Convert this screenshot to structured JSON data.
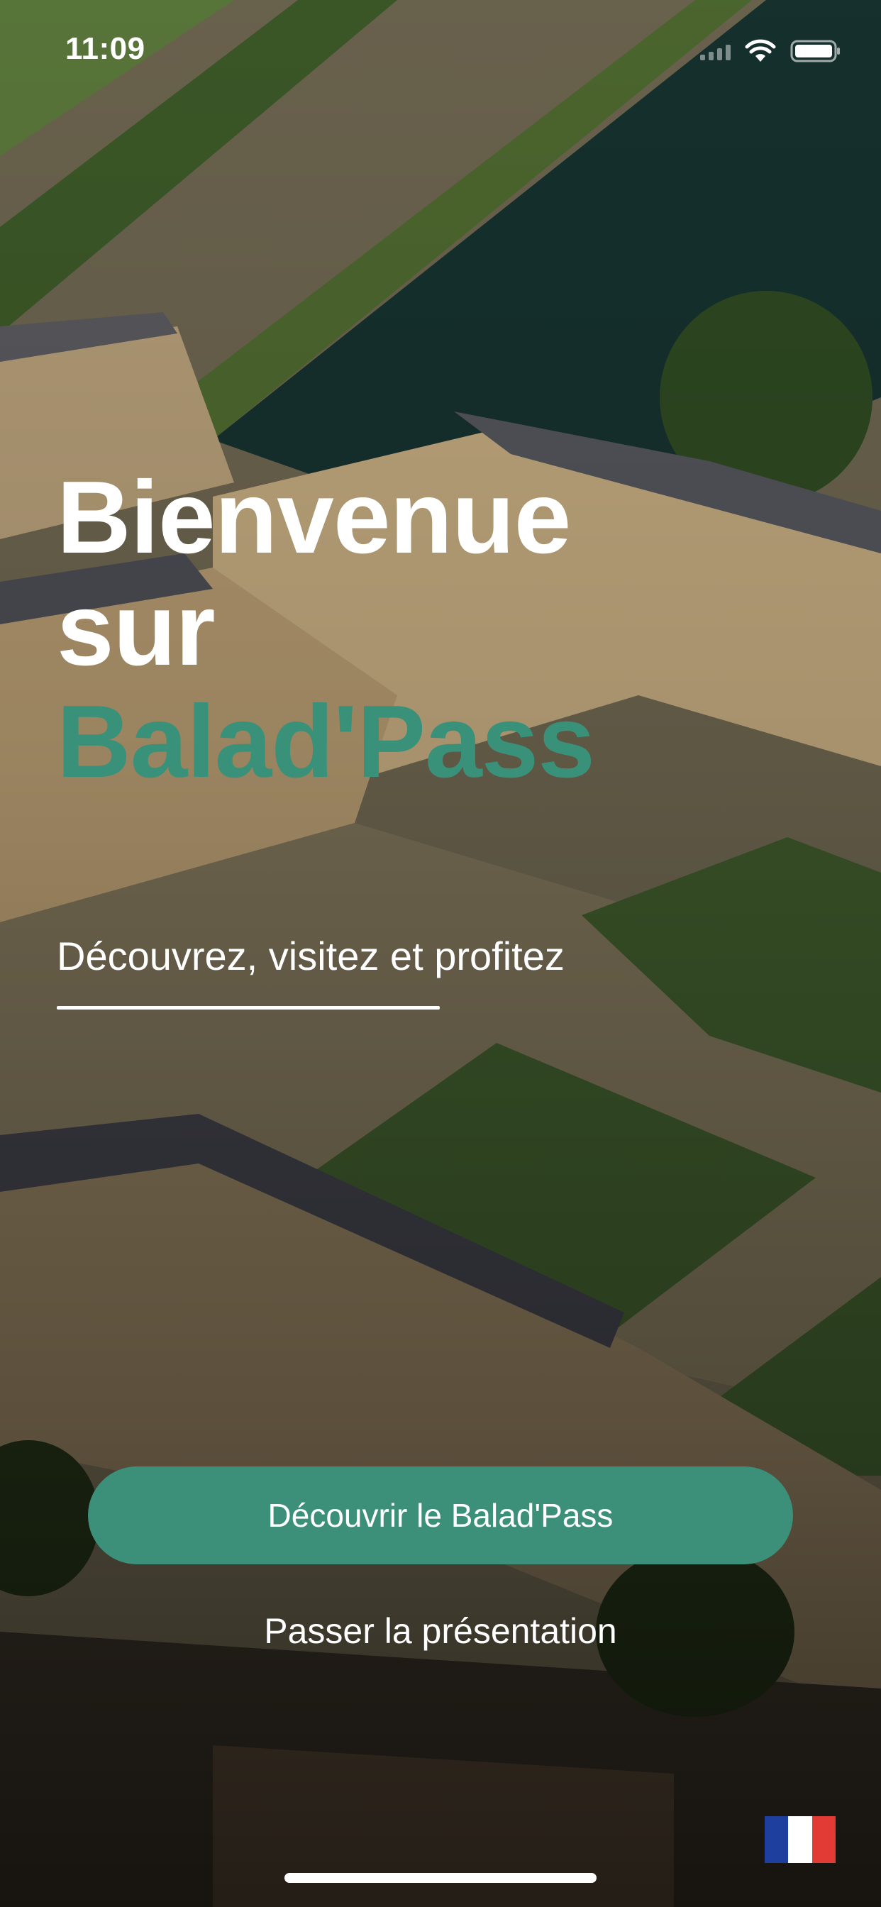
{
  "status_bar": {
    "time": "11:09",
    "wifi_icon": "wifi-icon",
    "battery_icon": "battery-icon",
    "signal_icon": "cellular-signal-icon"
  },
  "hero": {
    "line1": "Bienvenue",
    "line2": "sur",
    "brand": "Balad'Pass",
    "tagline": "Découvrez, visitez et profitez"
  },
  "actions": {
    "primary_label": "Découvrir le Balad'Pass",
    "skip_label": "Passer la présentation"
  },
  "language": {
    "flag_icon": "france-flag-icon"
  },
  "colors": {
    "accent": "#3a9179",
    "button": "#3c907a",
    "flag_blue": "#1f3f9e",
    "flag_white": "#ffffff",
    "flag_red": "#e23a34"
  }
}
